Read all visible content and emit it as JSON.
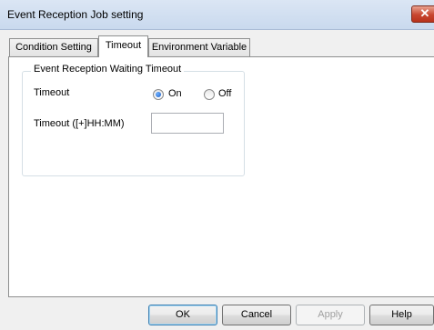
{
  "window": {
    "title": "Event Reception Job setting",
    "close_glyph": "✕"
  },
  "tabs": [
    {
      "label": "Condition Setting",
      "active": false
    },
    {
      "label": "Timeout",
      "active": true
    },
    {
      "label": "Environment Variable",
      "active": false
    }
  ],
  "group": {
    "title": "Event Reception Waiting Timeout",
    "timeout_label": "Timeout",
    "radio_on_label": "On",
    "radio_off_label": "Off",
    "selected": "On",
    "duration_label": "Timeout ([+]HH:MM)",
    "duration_value": ""
  },
  "buttons": {
    "ok": "OK",
    "cancel": "Cancel",
    "apply": "Apply",
    "help": "Help"
  },
  "colors": {
    "accent_radio": "#1d5ec7",
    "close_button": "#c7462f"
  }
}
